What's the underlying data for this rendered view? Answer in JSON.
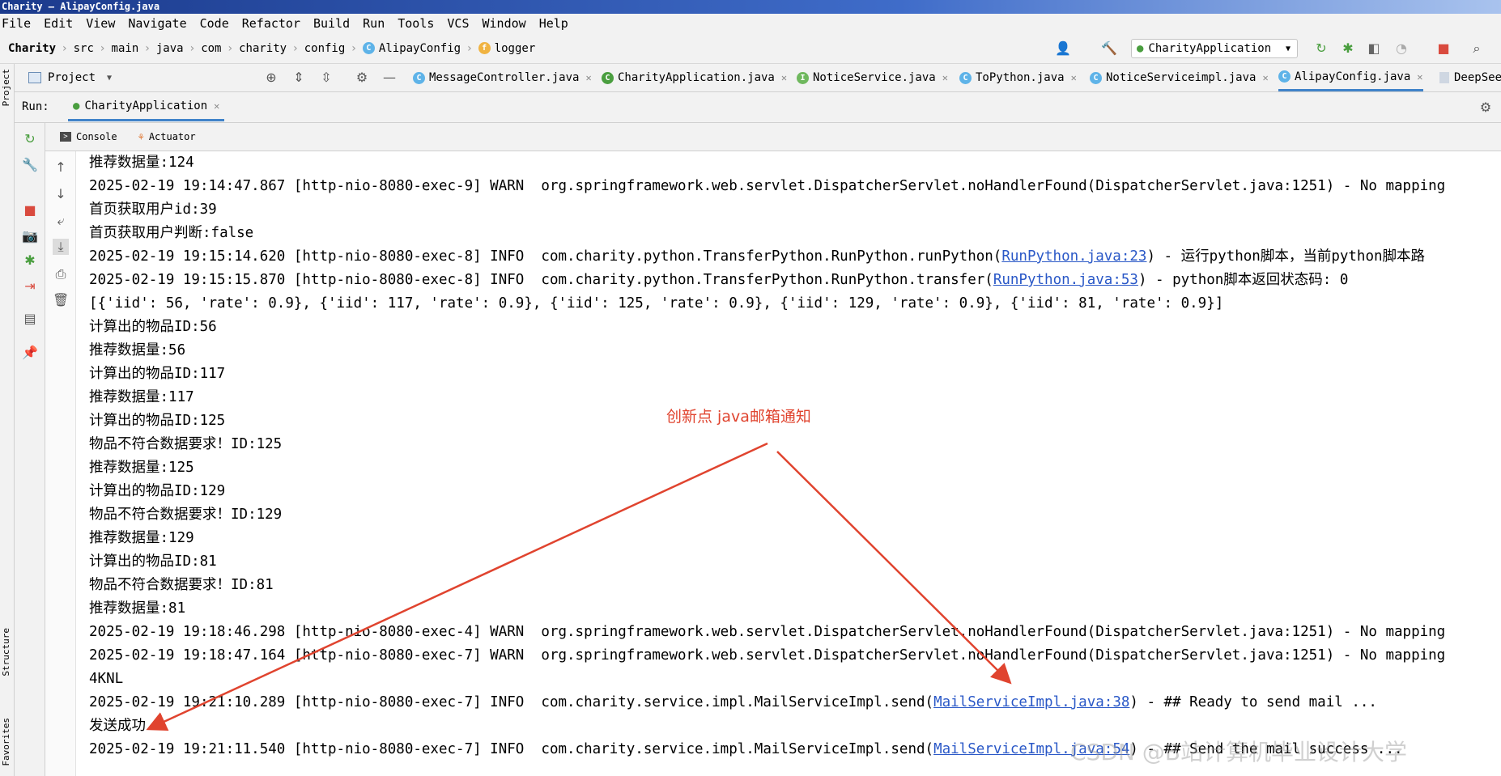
{
  "window": {
    "title": "Charity – AlipayConfig.java"
  },
  "menu": [
    "File",
    "Edit",
    "View",
    "Navigate",
    "Code",
    "Refactor",
    "Build",
    "Run",
    "Tools",
    "VCS",
    "Window",
    "Help"
  ],
  "breadcrumb": [
    "Charity",
    "src",
    "main",
    "java",
    "com",
    "charity",
    "config",
    "AlipayConfig",
    "logger"
  ],
  "run_config": "CharityApplication",
  "project_tool": {
    "label": "Project"
  },
  "editor_tabs": [
    {
      "label": "MessageController.java"
    },
    {
      "label": "CharityApplication.java"
    },
    {
      "label": "NoticeService.java"
    },
    {
      "label": "ToPython.java"
    },
    {
      "label": "NoticeServiceimpl.java"
    },
    {
      "label": "AlipayConfig.java"
    },
    {
      "label": "DeepSee"
    }
  ],
  "run_panel": {
    "label": "Run:",
    "tab": "CharityApplication",
    "console_tab": "Console",
    "actuator_tab": "Actuator"
  },
  "side_labels": {
    "project": "Project",
    "structure": "Structure",
    "favorites": "Favorites"
  },
  "console_lines": [
    {
      "text": "推荐数据量:124"
    },
    {
      "text": "2025-02-19 19:14:47.867 [http-nio-8080-exec-9] WARN  org.springframework.web.servlet.DispatcherServlet.noHandlerFound(DispatcherServlet.java:1251) - No mapping"
    },
    {
      "text": "首页获取用户id:39"
    },
    {
      "text": "首页获取用户判断:false"
    },
    {
      "pre": "2025-02-19 19:15:14.620 [http-nio-8080-exec-8] INFO  com.charity.python.TransferPython.RunPython.runPython(",
      "link": "RunPython.java:23",
      "post": ") - 运行python脚本，当前python脚本路"
    },
    {
      "pre": "2025-02-19 19:15:15.870 [http-nio-8080-exec-8] INFO  com.charity.python.TransferPython.RunPython.transfer(",
      "link": "RunPython.java:53",
      "post": ") - python脚本返回状态码: 0"
    },
    {
      "text": "[{'iid': 56, 'rate': 0.9}, {'iid': 117, 'rate': 0.9}, {'iid': 125, 'rate': 0.9}, {'iid': 129, 'rate': 0.9}, {'iid': 81, 'rate': 0.9}]"
    },
    {
      "text": "计算出的物品ID:56"
    },
    {
      "text": "推荐数据量:56"
    },
    {
      "text": "计算出的物品ID:117"
    },
    {
      "text": "推荐数据量:117"
    },
    {
      "text": "计算出的物品ID:125"
    },
    {
      "text": "物品不符合数据要求！ID:125"
    },
    {
      "text": "推荐数据量:125"
    },
    {
      "text": "计算出的物品ID:129"
    },
    {
      "text": "物品不符合数据要求！ID:129"
    },
    {
      "text": "推荐数据量:129"
    },
    {
      "text": "计算出的物品ID:81"
    },
    {
      "text": "物品不符合数据要求！ID:81"
    },
    {
      "text": "推荐数据量:81"
    },
    {
      "text": "2025-02-19 19:18:46.298 [http-nio-8080-exec-4] WARN  org.springframework.web.servlet.DispatcherServlet.noHandlerFound(DispatcherServlet.java:1251) - No mapping"
    },
    {
      "text": "2025-02-19 19:18:47.164 [http-nio-8080-exec-7] WARN  org.springframework.web.servlet.DispatcherServlet.noHandlerFound(DispatcherServlet.java:1251) - No mapping"
    },
    {
      "text": "4KNL"
    },
    {
      "pre": "2025-02-19 19:21:10.289 [http-nio-8080-exec-7] INFO  com.charity.service.impl.MailServiceImpl.send(",
      "link": "MailServiceImpl.java:38",
      "post": ") - ## Ready to send mail ..."
    },
    {
      "text": "发送成功"
    },
    {
      "pre": "2025-02-19 19:21:11.540 [http-nio-8080-exec-7] INFO  com.charity.service.impl.MailServiceImpl.send(",
      "link": "MailServiceImpl.java:54",
      "post": ") - ## Send the mail success ..."
    }
  ],
  "annotation": "创新点 java邮箱通知",
  "watermark": "CSDN @B站计算机毕业设计大学",
  "colors": {
    "annotation": "#e0442f",
    "link": "#2a58c7",
    "accent": "#4083c9"
  }
}
